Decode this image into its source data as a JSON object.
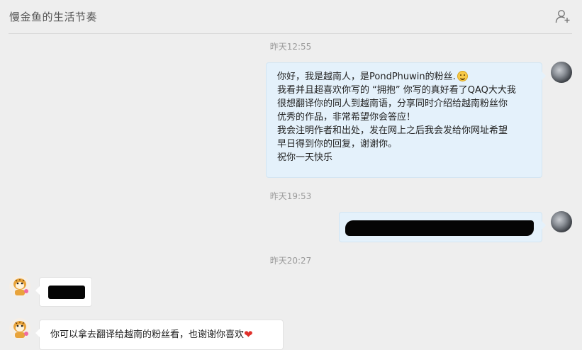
{
  "header": {
    "title": "慢金鱼的生活节奏",
    "add_user_icon": "add-user-icon"
  },
  "messages": [
    {
      "timestamp": "昨天12:55",
      "direction": "out",
      "lines": [
        "你好，我是越南人，是PondPhuwin的粉丝.",
        "我看并且超喜欢你写的 “拥抱” 你写的真好看了QAQ大大我",
        "很想翻译你的同人到越南语，分享同时介绍给越南粉丝你",
        "优秀的作品，非常希望你会答应！",
        "我会注明作者和出处，发在网上之后我会发给你网址希望",
        "早日得到你的回复，谢谢你。",
        "祝你一天快乐"
      ],
      "emoji": "hug-emoji"
    },
    {
      "timestamp": "昨天19:53",
      "direction": "out",
      "redacted": true
    },
    {
      "timestamp": "昨天20:27",
      "direction": "in",
      "redacted": true
    },
    {
      "direction": "in",
      "text": "你可以拿去翻译给越南的粉丝看，也谢谢你喜欢",
      "emoji": "heart-emoji"
    }
  ],
  "colors": {
    "background": "#eeeeee",
    "outgoing_bubble": "#e4f1fb",
    "incoming_bubble": "#ffffff",
    "timestamp": "#9a9a9a",
    "heart": "#e0302b"
  }
}
